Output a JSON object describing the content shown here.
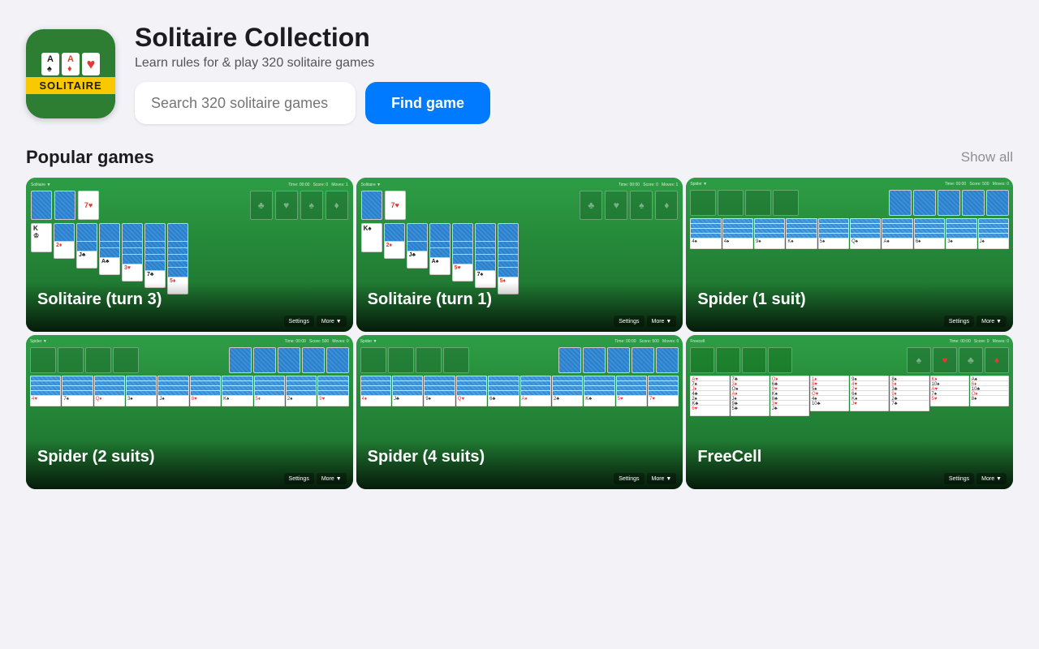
{
  "header": {
    "app_name": "Solitaire Collection",
    "app_subtitle": "Learn rules for & play 320 solitaire games",
    "app_icon_label": "SOLITAIRE"
  },
  "search": {
    "placeholder": "Search 320 solitaire games",
    "button_label": "Find game"
  },
  "popular_section": {
    "title": "Popular games",
    "show_all_label": "Show all"
  },
  "games": [
    {
      "title": "Solitaire (turn 3)",
      "type": "klondike3"
    },
    {
      "title": "Solitaire (turn 1)",
      "type": "klondike1"
    },
    {
      "title": "Spider (1 suit)",
      "type": "spider"
    },
    {
      "title": "Spider (2 suits)",
      "type": "spider2"
    },
    {
      "title": "Spider (4 suits)",
      "type": "spider4"
    },
    {
      "title": "FreeCell",
      "type": "freecell"
    }
  ],
  "colors": {
    "bg": "#f2f2f7",
    "table_green": "#2d9e45",
    "table_dark": "#1a6b2a",
    "blue": "#007aff",
    "gray_text": "#8e8e93"
  }
}
